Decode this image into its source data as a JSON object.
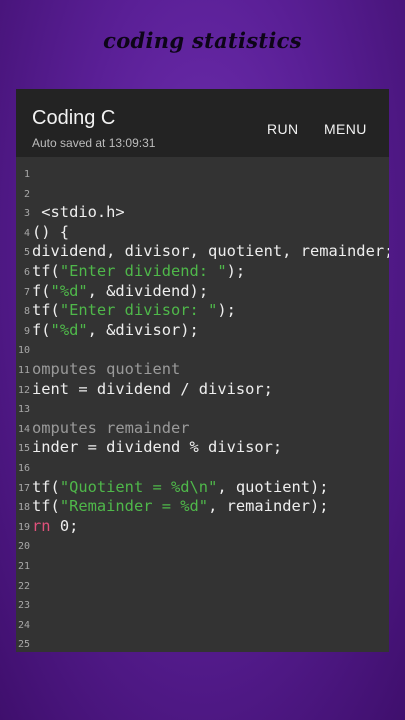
{
  "banner": "coding statistics",
  "app": {
    "title": "Coding C",
    "autosave": "Auto saved at 13:09:31",
    "actions": {
      "run": "RUN",
      "menu": "MENU"
    }
  },
  "colors": {
    "background": "#5a1f96",
    "editor_bg": "#333333",
    "appbar_bg": "#232323",
    "string": "#4fb84a",
    "comment": "#9a9a9a",
    "keyword": "#e0517b"
  },
  "editor": {
    "lines": [
      {
        "n": "1",
        "segments": []
      },
      {
        "n": "2",
        "segments": []
      },
      {
        "n": "3",
        "segments": [
          {
            "t": "p",
            "text": " <stdio.h>"
          }
        ]
      },
      {
        "n": "4",
        "segments": [
          {
            "t": "p",
            "text": "() {"
          }
        ]
      },
      {
        "n": "5",
        "segments": [
          {
            "t": "p",
            "text": "dividend, divisor, quotient, remainder;"
          }
        ]
      },
      {
        "n": "6",
        "segments": [
          {
            "t": "p",
            "text": "tf("
          },
          {
            "t": "s",
            "text": "\"Enter dividend: \""
          },
          {
            "t": "p",
            "text": ");"
          }
        ]
      },
      {
        "n": "7",
        "segments": [
          {
            "t": "p",
            "text": "f("
          },
          {
            "t": "s",
            "text": "\"%d\""
          },
          {
            "t": "p",
            "text": ", &dividend);"
          }
        ]
      },
      {
        "n": "8",
        "segments": [
          {
            "t": "p",
            "text": "tf("
          },
          {
            "t": "s",
            "text": "\"Enter divisor: \""
          },
          {
            "t": "p",
            "text": ");"
          }
        ]
      },
      {
        "n": "9",
        "segments": [
          {
            "t": "p",
            "text": "f("
          },
          {
            "t": "s",
            "text": "\"%d\""
          },
          {
            "t": "p",
            "text": ", &divisor);"
          }
        ]
      },
      {
        "n": "10",
        "segments": []
      },
      {
        "n": "11",
        "segments": [
          {
            "t": "c",
            "text": "omputes quotient"
          }
        ]
      },
      {
        "n": "12",
        "segments": [
          {
            "t": "p",
            "text": "ient = dividend / divisor;"
          }
        ]
      },
      {
        "n": "13",
        "segments": []
      },
      {
        "n": "14",
        "segments": [
          {
            "t": "c",
            "text": "omputes remainder"
          }
        ]
      },
      {
        "n": "15",
        "segments": [
          {
            "t": "p",
            "text": "inder = dividend % divisor;"
          }
        ]
      },
      {
        "n": "16",
        "segments": []
      },
      {
        "n": "17",
        "segments": [
          {
            "t": "p",
            "text": "tf("
          },
          {
            "t": "s",
            "text": "\"Quotient = %d\\n\""
          },
          {
            "t": "p",
            "text": ", quotient);"
          }
        ]
      },
      {
        "n": "18",
        "segments": [
          {
            "t": "p",
            "text": "tf("
          },
          {
            "t": "s",
            "text": "\"Remainder = %d\""
          },
          {
            "t": "p",
            "text": ", remainder);"
          }
        ]
      },
      {
        "n": "19",
        "segments": [
          {
            "t": "k",
            "text": "rn"
          },
          {
            "t": "p",
            "text": " 0;"
          }
        ]
      },
      {
        "n": "20",
        "segments": []
      },
      {
        "n": "21",
        "segments": []
      },
      {
        "n": "22",
        "segments": []
      },
      {
        "n": "23",
        "segments": []
      },
      {
        "n": "24",
        "segments": []
      },
      {
        "n": "25",
        "segments": []
      }
    ]
  }
}
